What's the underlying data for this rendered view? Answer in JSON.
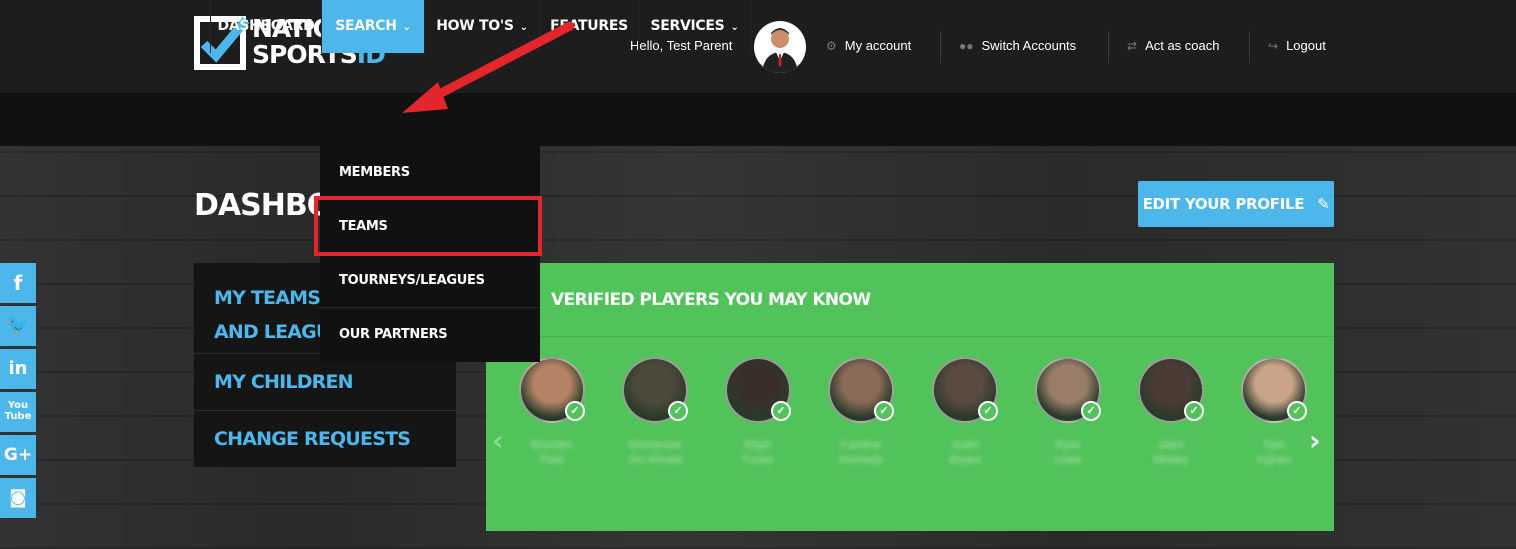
{
  "brand": {
    "line1": "NATIONAL",
    "line2a": "SPORTS",
    "line2b": "ID"
  },
  "header": {
    "greeting": "Hello, Test Parent",
    "links": {
      "my_account": "My account",
      "switch_accounts": "Switch Accounts",
      "act_as_coach": "Act as coach",
      "logout": "Logout"
    }
  },
  "nav": {
    "dashboard": "DASHBOARD",
    "search": "SEARCH",
    "howtos": "HOW TO'S",
    "features": "FEATURES",
    "services": "SERVICES"
  },
  "search_menu": {
    "members": "MEMBERS",
    "teams": "TEAMS",
    "tourneys": "TOURNEYS/LEAGUES",
    "partners": "OUR PARTNERS"
  },
  "page": {
    "title": "DASHBOARD",
    "edit_profile": "EDIT YOUR PROFILE"
  },
  "sidebar": {
    "teams_line1": "MY TEAMS, TOURNEYS",
    "teams_line2": "AND LEAGUES",
    "children": "MY CHILDREN",
    "change_requests": "CHANGE REQUESTS"
  },
  "verified": {
    "title": "VERIFIED PLAYERS YOU MAY KNOW",
    "players": [
      {
        "name1": "Brandon",
        "name2": "Field"
      },
      {
        "name1": "Emmanuel",
        "name2": "Jim Ahmed"
      },
      {
        "name1": "Elijah",
        "name2": "Tucker"
      },
      {
        "name1": "Caroline",
        "name2": "Kennedy"
      },
      {
        "name1": "Justin",
        "name2": "Bryant"
      },
      {
        "name1": "Ryan",
        "name2": "Lewis"
      },
      {
        "name1": "Jalen",
        "name2": "Mosley"
      },
      {
        "name1": "Tyler",
        "name2": "Ingram"
      }
    ]
  }
}
